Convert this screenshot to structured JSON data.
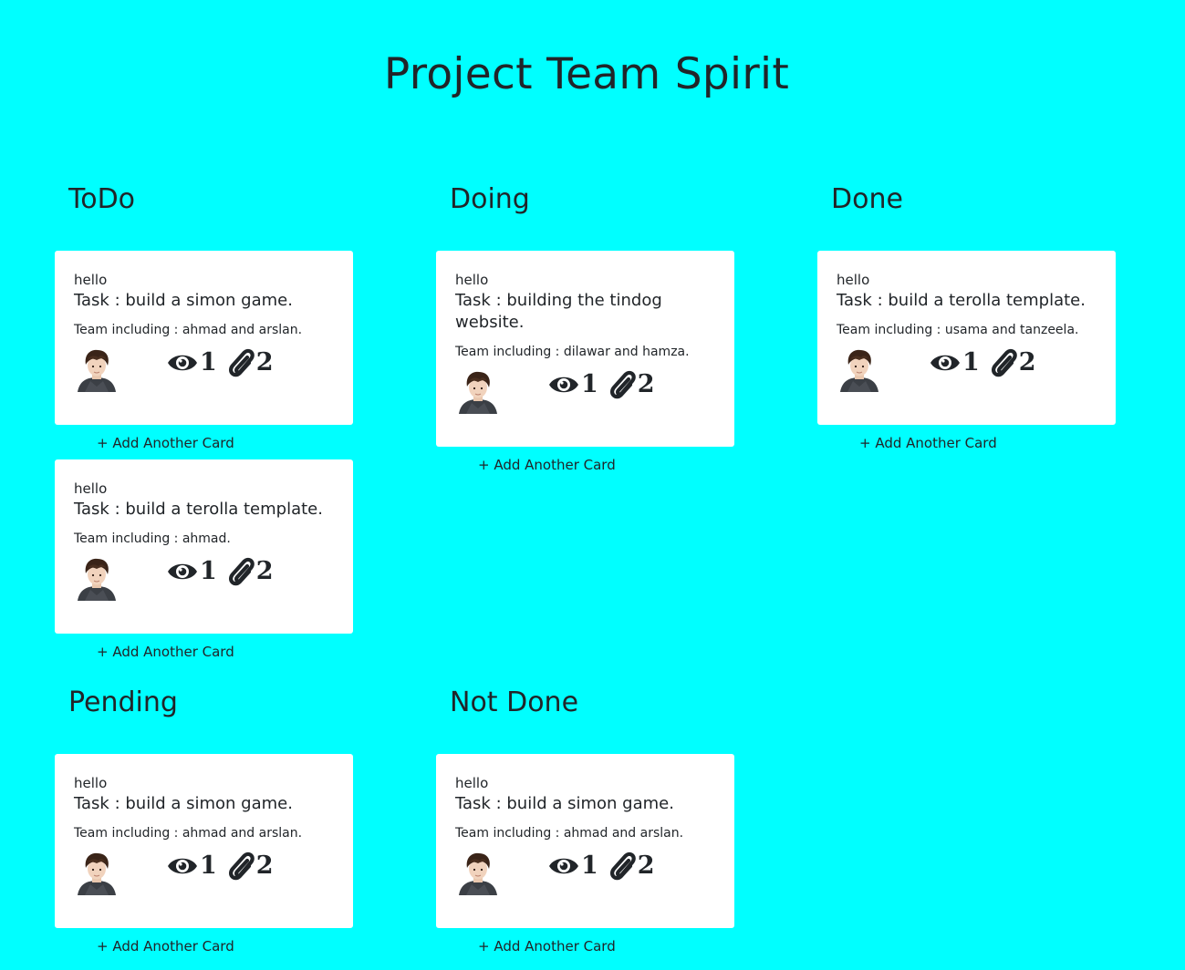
{
  "page": {
    "title": "Project Team Spirit",
    "background_color": "#00ffff"
  },
  "lists": [
    {
      "title": "ToDo",
      "cards": [
        {
          "hello": "hello",
          "task": "Task : build a simon game.",
          "team": "Team including : ahmad and arslan.",
          "views": "1",
          "attachments": "2",
          "add_label": "+ Add Another Card"
        },
        {
          "hello": "hello",
          "task": "Task : build a terolla template.",
          "team": "Team including : ahmad.",
          "views": "1",
          "attachments": "2",
          "add_label": "+ Add Another Card"
        }
      ]
    },
    {
      "title": "Doing",
      "cards": [
        {
          "hello": "hello",
          "task": "Task : building the tindog website.",
          "team": "Team including : dilawar and hamza.",
          "views": "1",
          "attachments": "2",
          "add_label": "+ Add Another Card"
        }
      ]
    },
    {
      "title": "Done",
      "cards": [
        {
          "hello": "hello",
          "task": "Task : build a terolla template.",
          "team": "Team including : usama and tanzeela.",
          "views": "1",
          "attachments": "2",
          "add_label": "+ Add Another Card"
        }
      ]
    },
    {
      "title": "Pending",
      "cards": [
        {
          "hello": "hello",
          "task": "Task : build a simon game.",
          "team": "Team including : ahmad and arslan.",
          "views": "1",
          "attachments": "2",
          "add_label": "+ Add Another Card"
        }
      ]
    },
    {
      "title": "Not Done",
      "cards": [
        {
          "hello": "hello",
          "task": "Task : build a simon game.",
          "team": "Team including : ahmad and arslan.",
          "views": "1",
          "attachments": "2",
          "add_label": "+ Add Another Card"
        }
      ]
    }
  ],
  "icons": {
    "views": "eye-icon",
    "attachments": "paperclip-icon",
    "avatar": "user-avatar"
  }
}
